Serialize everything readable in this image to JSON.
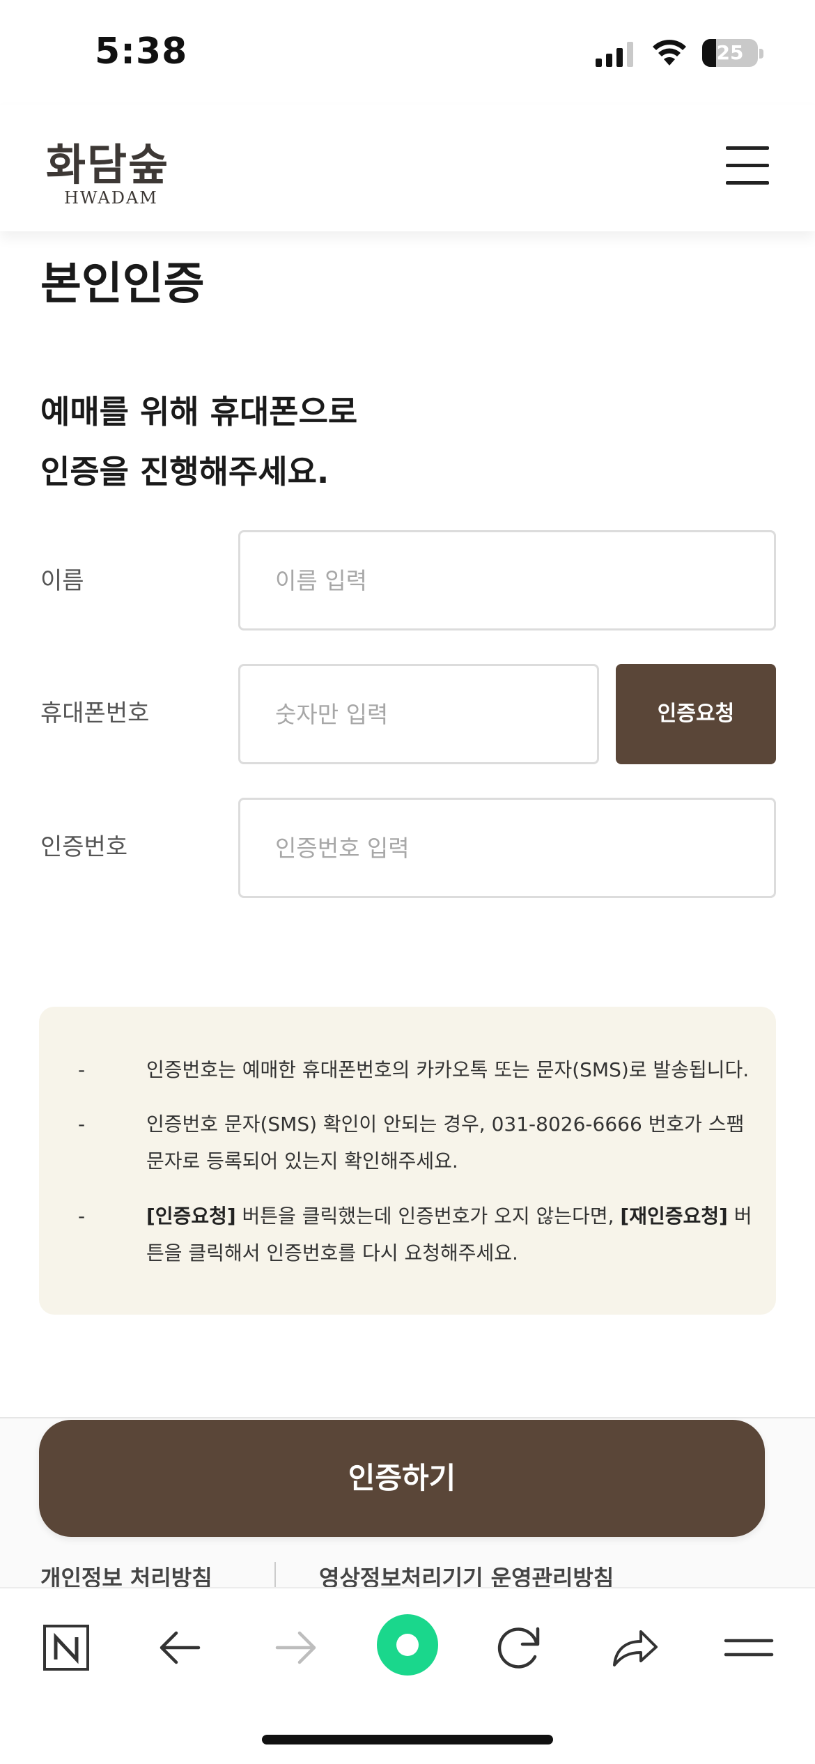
{
  "status_bar": {
    "time": "5:38",
    "battery_level": "25",
    "battery_fraction": 0.25
  },
  "header": {
    "logo_korean": "화담숲",
    "logo_english": "HWADAM",
    "menu_icon": "hamburger-menu-icon"
  },
  "page": {
    "title": "본인인증",
    "subtitle_line1": "예매를 위해 휴대폰으로",
    "subtitle_line2": "인증을 진행해주세요."
  },
  "form": {
    "name": {
      "label": "이름",
      "placeholder": "이름 입력",
      "value": ""
    },
    "phone": {
      "label": "휴대폰번호",
      "placeholder": "숫자만 입력",
      "value": ""
    },
    "request_button": "인증요청",
    "code": {
      "label": "인증번호",
      "placeholder": "인증번호 입력",
      "value": ""
    }
  },
  "notice": {
    "dash": "-",
    "item1": "인증번호는 예매한 휴대폰번호의 카카오톡 또는 문자(SMS)로 발송됩니다.",
    "item2": "인증번호 문자(SMS) 확인이 안되는 경우, 031-8026-6666 번호가 스팸 문자로 등록되어 있는지 확인해주세요.",
    "item3_bold1": "[인증요청]",
    "item3_mid": " 버튼을 클릭했는데 인증번호가 오지 않는다면, ",
    "item3_bold2": "[재인증요청]",
    "item3_end": " 버튼을 클릭해서 인증번호를 다시 요청해주세요."
  },
  "cta": {
    "label": "인증하기"
  },
  "footer": {
    "privacy_link": "개인정보 처리방침",
    "cctv_link": "영상정보처리기기 운영관리방침"
  },
  "browser_toolbar": {
    "icons": [
      "naver-n-icon",
      "back-arrow-icon",
      "forward-arrow-icon",
      "green-circle-icon",
      "reload-icon",
      "share-icon",
      "menu-icon"
    ],
    "accent_color": "#1ad78c"
  },
  "colors": {
    "brand_brown": "#5a4638",
    "notice_bg": "#f7f4ea"
  }
}
